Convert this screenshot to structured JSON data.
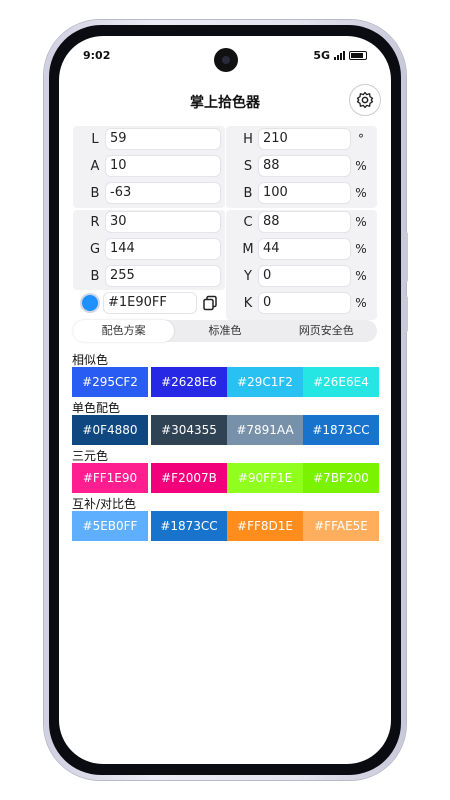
{
  "status": {
    "time": "9:02",
    "network": "5G"
  },
  "app": {
    "title": "掌上拾色器"
  },
  "lab": [
    {
      "label": "L",
      "value": "59"
    },
    {
      "label": "A",
      "value": "10"
    },
    {
      "label": "B",
      "value": "-63"
    }
  ],
  "hsb": [
    {
      "label": "H",
      "value": "210",
      "unit": "°"
    },
    {
      "label": "S",
      "value": "88",
      "unit": "%"
    },
    {
      "label": "B",
      "value": "100",
      "unit": "%"
    }
  ],
  "rgb": [
    {
      "label": "R",
      "value": "30"
    },
    {
      "label": "G",
      "value": "144"
    },
    {
      "label": "B",
      "value": "255"
    }
  ],
  "cmyk": [
    {
      "label": "C",
      "value": "88",
      "unit": "%"
    },
    {
      "label": "M",
      "value": "44",
      "unit": "%"
    },
    {
      "label": "Y",
      "value": "0",
      "unit": "%"
    },
    {
      "label": "K",
      "value": "0",
      "unit": "%"
    }
  ],
  "hex": {
    "value": "#1E90FF",
    "swatch_color": "#1E90FF"
  },
  "tabs": [
    {
      "label": "配色方案",
      "active": true
    },
    {
      "label": "标准色",
      "active": false
    },
    {
      "label": "网页安全色",
      "active": false
    }
  ],
  "palettes": [
    {
      "title": "相似色",
      "colors": [
        {
          "hex": "#295CF2",
          "label": "#295CF2"
        },
        {
          "hex": "#2628E6",
          "label": "#2628E6"
        },
        {
          "hex": "#29C1F2",
          "label": "#29C1F2"
        },
        {
          "hex": "#26E6E4",
          "label": "#26E6E4"
        }
      ]
    },
    {
      "title": "单色配色",
      "colors": [
        {
          "hex": "#0F4880",
          "label": "#0F4880"
        },
        {
          "hex": "#304355",
          "label": "#304355"
        },
        {
          "hex": "#7891AA",
          "label": "#7891AA"
        },
        {
          "hex": "#1873CC",
          "label": "#1873CC"
        }
      ]
    },
    {
      "title": "三元色",
      "colors": [
        {
          "hex": "#FF1E90",
          "label": "#FF1E90"
        },
        {
          "hex": "#F2007B",
          "label": "#F2007B"
        },
        {
          "hex": "#90FF1E",
          "label": "#90FF1E"
        },
        {
          "hex": "#7BF200",
          "label": "#7BF200"
        }
      ]
    },
    {
      "title": "互补/对比色",
      "colors": [
        {
          "hex": "#5EB0FF",
          "label": "#5EB0FF"
        },
        {
          "hex": "#1873CC",
          "label": "#1873CC"
        },
        {
          "hex": "#FF8D1E",
          "label": "#FF8D1E"
        },
        {
          "hex": "#FFAE5E",
          "label": "#FFAE5E"
        }
      ]
    }
  ],
  "icons": {
    "settings": "settings-gear-icon",
    "copy": "copy-icon"
  }
}
